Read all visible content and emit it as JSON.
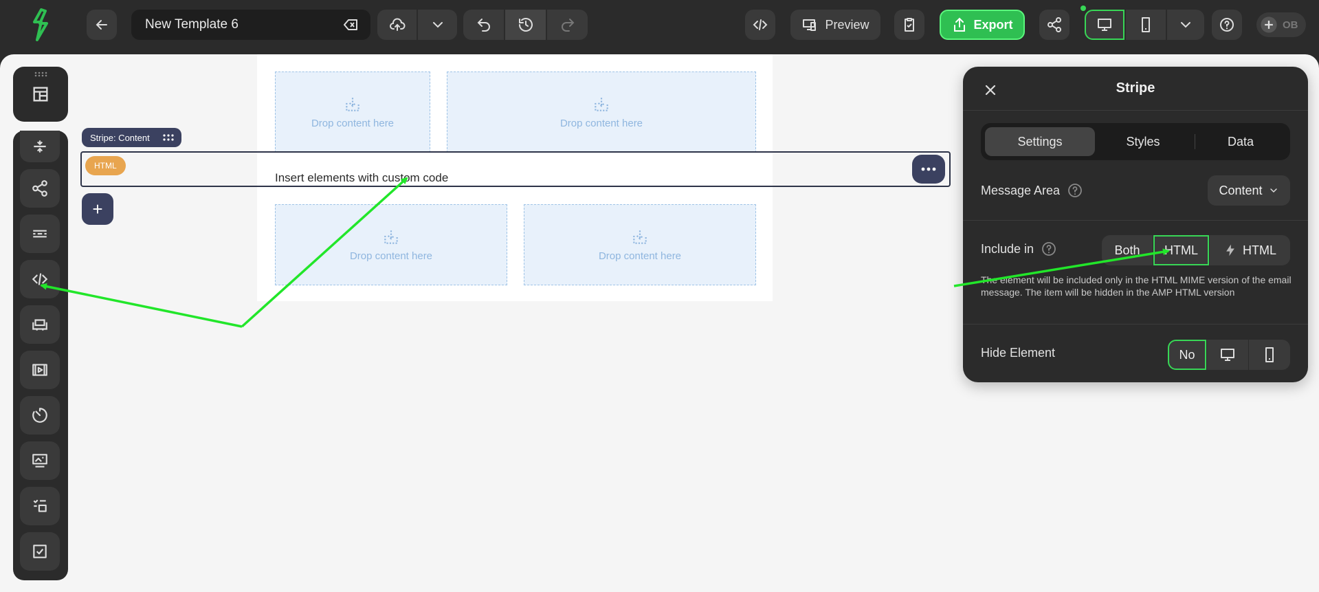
{
  "topbar": {
    "template_name": "New Template 6",
    "preview_label": "Preview",
    "export_label": "Export",
    "avatar_initials": "OB"
  },
  "canvas": {
    "drop_label": "Drop content here",
    "stripe_tag": "Stripe: Content",
    "html_badge": "HTML",
    "insert_text": "Insert elements with custom code",
    "add_symbol": "+"
  },
  "panel": {
    "title": "Stripe",
    "tabs": [
      "Settings",
      "Styles",
      "Data"
    ],
    "active_tab": "Settings",
    "message_area": {
      "label": "Message Area",
      "value": "Content"
    },
    "include_in": {
      "label": "Include in",
      "options": [
        "Both",
        "HTML",
        "HTML"
      ],
      "selected": "HTML",
      "description": "The element will be included only in the HTML MIME version of the email message. The item will be hidden in the AMP HTML version"
    },
    "hide_element": {
      "label": "Hide Element",
      "value": "No"
    }
  },
  "colors": {
    "accent_green": "#2fbf52",
    "highlight_green": "#38d756",
    "badge_orange": "#e8a54f",
    "stripe_navy": "#3b4160",
    "drop_bg": "#e8f1fb"
  },
  "icons": {
    "logo": "stripo-logo-icon",
    "back": "arrow-left-icon",
    "clear": "backspace-icon",
    "save": "cloud-upload-icon",
    "undo": "undo-icon",
    "history": "history-icon",
    "redo": "redo-icon",
    "code": "code-icon",
    "test": "clipboard-check-icon",
    "share": "share-icon",
    "desktop": "desktop-icon",
    "mobile": "mobile-icon",
    "help": "help-icon"
  }
}
